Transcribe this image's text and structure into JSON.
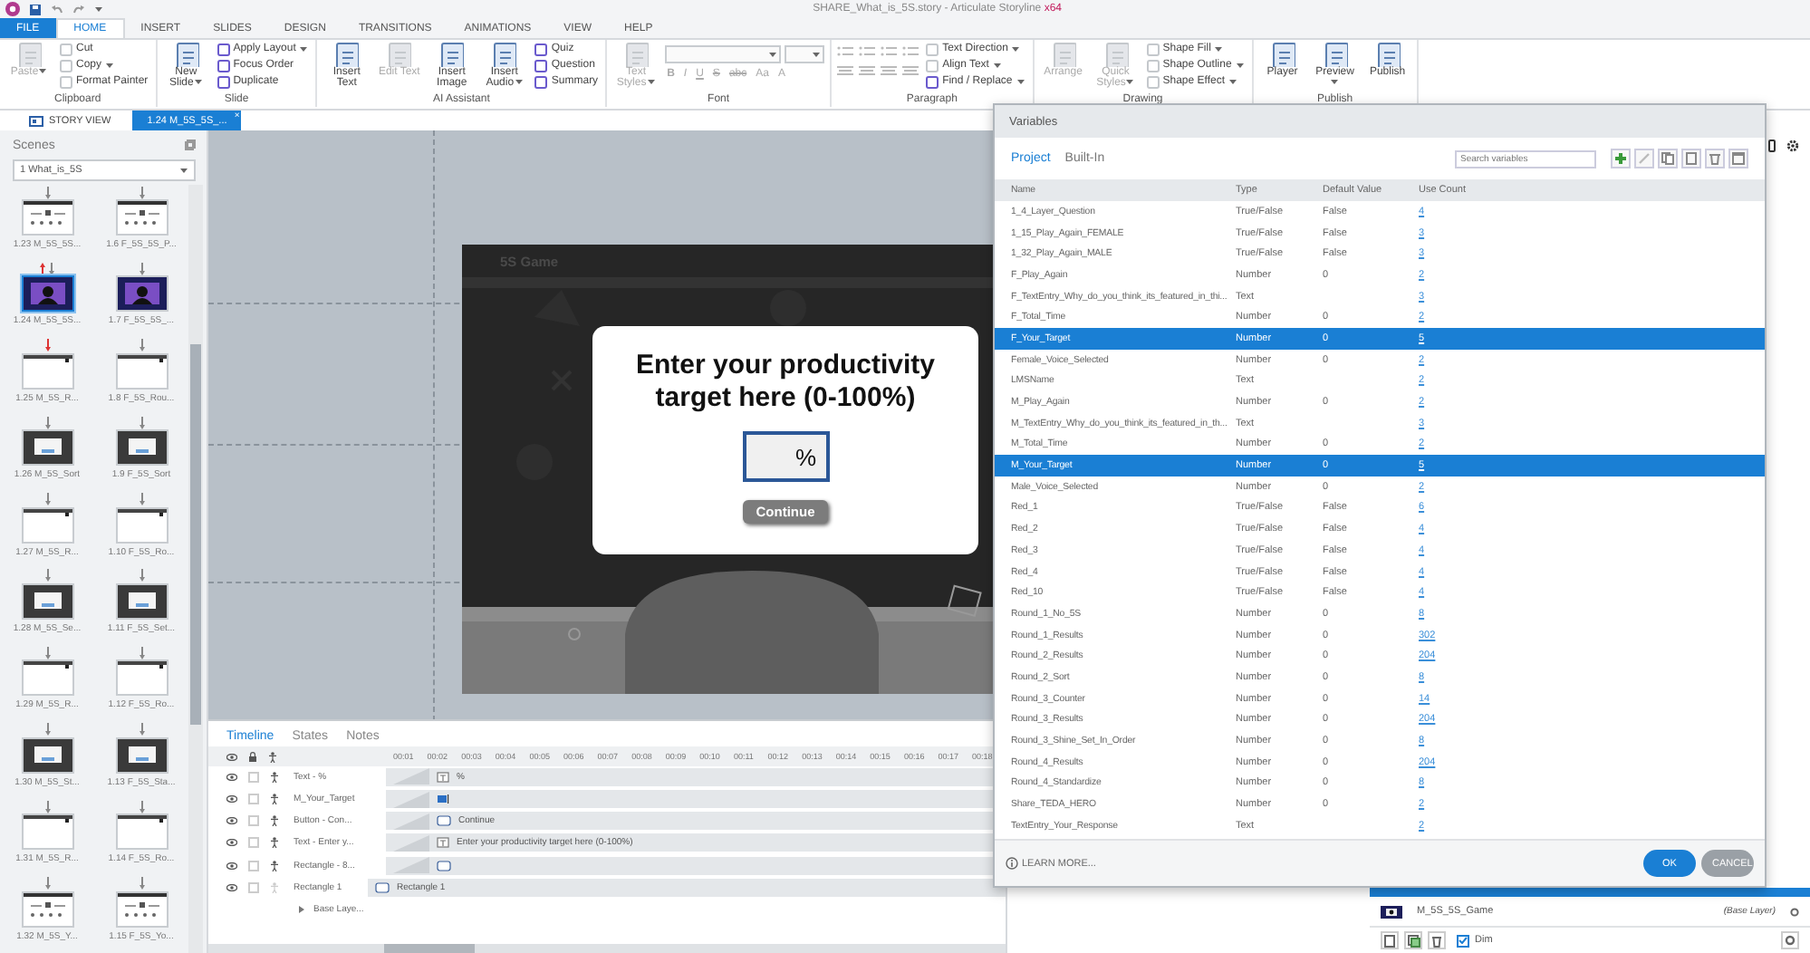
{
  "window": {
    "title": "SHARE_What_is_5S.story - Articulate Storyline",
    "title_suffix": "x64"
  },
  "ribbon_tabs": [
    {
      "label": "FILE",
      "kind": "file",
      "selected": false
    },
    {
      "label": "HOME",
      "kind": "tab",
      "selected": true
    },
    {
      "label": "INSERT",
      "kind": "tab",
      "selected": false
    },
    {
      "label": "SLIDES",
      "kind": "tab",
      "selected": false
    },
    {
      "label": "DESIGN",
      "kind": "tab",
      "selected": false
    },
    {
      "label": "TRANSITIONS",
      "kind": "tab",
      "selected": false
    },
    {
      "label": "ANIMATIONS",
      "kind": "tab",
      "selected": false
    },
    {
      "label": "VIEW",
      "kind": "tab",
      "selected": false
    },
    {
      "label": "HELP",
      "kind": "tab",
      "selected": false
    }
  ],
  "ribbon_groups": [
    {
      "name": "Clipboard",
      "items": [
        {
          "kind": "large",
          "label": "Paste",
          "disabled": true,
          "dropdown": true
        },
        {
          "kind": "stack",
          "buttons": [
            {
              "label": "Cut",
              "disabled": true,
              "dropdown": false
            },
            {
              "label": "Copy",
              "disabled": true,
              "dropdown": true
            },
            {
              "label": "Format Painter",
              "disabled": true,
              "dropdown": false
            }
          ]
        }
      ]
    },
    {
      "name": "Slide",
      "items": [
        {
          "kind": "large",
          "label": "New Slide",
          "disabled": false,
          "dropdown": true
        },
        {
          "kind": "stack",
          "buttons": [
            {
              "label": "Apply Layout",
              "disabled": false,
              "dropdown": true
            },
            {
              "label": "Focus Order",
              "disabled": false,
              "dropdown": false
            },
            {
              "label": "Duplicate",
              "disabled": false,
              "dropdown": false
            }
          ]
        }
      ]
    },
    {
      "name": "AI Assistant",
      "items": [
        {
          "kind": "large",
          "label": "Insert Text",
          "disabled": false,
          "dropdown": false
        },
        {
          "kind": "large",
          "label": "Edit Text",
          "disabled": true,
          "dropdown": false
        },
        {
          "kind": "large",
          "label": "Insert Image",
          "disabled": false,
          "dropdown": false
        },
        {
          "kind": "large",
          "label": "Insert Audio",
          "disabled": false,
          "dropdown": true
        },
        {
          "kind": "stack",
          "buttons": [
            {
              "label": "Quiz",
              "disabled": false,
              "dropdown": false
            },
            {
              "label": "Question",
              "disabled": false,
              "dropdown": false
            },
            {
              "label": "Summary",
              "disabled": false,
              "dropdown": false
            }
          ]
        }
      ]
    },
    {
      "name": "Font",
      "items": [
        {
          "kind": "large",
          "label": "Text Styles",
          "disabled": true,
          "dropdown": true
        },
        {
          "kind": "font",
          "buttons": [
            {
              "label": "B"
            },
            {
              "label": "I"
            },
            {
              "label": "U"
            },
            {
              "label": "S"
            },
            {
              "label": "abc"
            },
            {
              "label": "Aa"
            },
            {
              "label": "A"
            }
          ]
        }
      ]
    },
    {
      "name": "Paragraph",
      "items": [
        {
          "kind": "paragraph"
        },
        {
          "kind": "stack",
          "buttons": [
            {
              "label": "Text Direction",
              "disabled": true,
              "dropdown": true
            },
            {
              "label": "Align Text",
              "disabled": true,
              "dropdown": true
            },
            {
              "label": "Find / Replace",
              "disabled": false,
              "dropdown": true
            }
          ]
        }
      ]
    },
    {
      "name": "Drawing",
      "items": [
        {
          "kind": "large",
          "label": "Arrange",
          "disabled": true,
          "dropdown": false
        },
        {
          "kind": "large",
          "label": "Quick Styles",
          "disabled": true,
          "dropdown": true
        },
        {
          "kind": "stack",
          "buttons": [
            {
              "label": "Shape Fill",
              "disabled": true,
              "dropdown": true
            },
            {
              "label": "Shape Outline",
              "disabled": true,
              "dropdown": true
            },
            {
              "label": "Shape Effect",
              "disabled": true,
              "dropdown": true
            }
          ]
        }
      ]
    },
    {
      "name": "Publish",
      "items": [
        {
          "kind": "large",
          "label": "Player",
          "disabled": false,
          "dropdown": false
        },
        {
          "kind": "large",
          "label": "Preview",
          "disabled": false,
          "dropdown": true
        },
        {
          "kind": "large",
          "label": "Publish",
          "disabled": false,
          "dropdown": false
        }
      ]
    }
  ],
  "doc_tabs": [
    {
      "label": "STORY VIEW",
      "kind": "story",
      "selected": false
    },
    {
      "label": "1.24 M_5S_5S_...",
      "kind": "slide",
      "selected": true,
      "close": "×"
    }
  ],
  "scenes": {
    "title": "Scenes",
    "scene": "1 What_is_5S",
    "slides": [
      {
        "label": "1.23 M_5S_5S...",
        "kind": "calendar",
        "selected": false
      },
      {
        "label": "1.6 F_5S_5S_P...",
        "kind": "calendar",
        "selected": false
      },
      {
        "label": "1.24 M_5S_5S...",
        "kind": "purple",
        "selected": true
      },
      {
        "label": "1.7 F_5S_5S_...",
        "kind": "purple",
        "selected": false
      },
      {
        "label": "1.25 M_5S_R...",
        "kind": "white",
        "selected": false
      },
      {
        "label": "1.8 F_5S_Rou...",
        "kind": "white",
        "selected": false
      },
      {
        "label": "1.26 M_5S_Sort",
        "kind": "dark",
        "selected": false
      },
      {
        "label": "1.9 F_5S_Sort",
        "kind": "dark",
        "selected": false
      },
      {
        "label": "1.27 M_5S_R...",
        "kind": "white",
        "selected": false
      },
      {
        "label": "1.10 F_5S_Ro...",
        "kind": "white",
        "selected": false
      },
      {
        "label": "1.28 M_5S_Se...",
        "kind": "dark",
        "selected": false
      },
      {
        "label": "1.11 F_5S_Set...",
        "kind": "dark",
        "selected": false
      },
      {
        "label": "1.29 M_5S_R...",
        "kind": "white",
        "selected": false
      },
      {
        "label": "1.12 F_5S_Ro...",
        "kind": "white",
        "selected": false
      },
      {
        "label": "1.30 M_5S_St...",
        "kind": "dark",
        "selected": false
      },
      {
        "label": "1.13 F_5S_Sta...",
        "kind": "dark",
        "selected": false
      },
      {
        "label": "1.31 M_5S_R...",
        "kind": "white",
        "selected": false
      },
      {
        "label": "1.14 F_5S_Ro...",
        "kind": "white",
        "selected": false
      },
      {
        "label": "1.32 M_5S_Y...",
        "kind": "calendar",
        "selected": false
      },
      {
        "label": "1.15 F_5S_Yo...",
        "kind": "calendar",
        "selected": false
      }
    ]
  },
  "stage": {
    "slide_title": "5S Game",
    "prompt": "Enter your productivity target here (0-100%)",
    "input_value": "%",
    "button": "Continue"
  },
  "timeline": {
    "tabs": [
      {
        "label": "Timeline",
        "selected": true
      },
      {
        "label": "States",
        "selected": false
      },
      {
        "label": "Notes",
        "selected": false
      }
    ],
    "ticks": [
      "00:01",
      "00:02",
      "00:03",
      "00:04",
      "00:05",
      "00:06",
      "00:07",
      "00:08",
      "00:09",
      "00:10",
      "00:11",
      "00:12",
      "00:13",
      "00:14",
      "00:15",
      "00:16",
      "00:17",
      "00:18"
    ],
    "layers": [
      {
        "name": "Text - %",
        "bar_label": "%",
        "kind": "text",
        "locked": false,
        "locked_icon": true
      },
      {
        "name": "M_Your_Target",
        "kind": "entry",
        "locked": false,
        "locked_icon": true
      },
      {
        "name": "Button - Con...",
        "bar_label": "Continue",
        "kind": "shape",
        "locked": false,
        "locked_icon": true
      },
      {
        "name": "Text - Enter y...",
        "bar_label": "Enter your productivity target here (0-100%)",
        "kind": "text",
        "locked": false,
        "locked_icon": true
      },
      {
        "name": "Rectangle - 8...",
        "kind": "shape",
        "locked": false,
        "locked_icon": true
      },
      {
        "name": "Rectangle 1",
        "bar_label": "Rectangle 1",
        "kind": "base",
        "locked": false,
        "locked_icon": false
      }
    ],
    "base_layer": "Base Laye..."
  },
  "variables": {
    "title": "Variables",
    "tabs": [
      {
        "label": "Project",
        "selected": true
      },
      {
        "label": "Built-In",
        "selected": false
      }
    ],
    "search_placeholder": "Search variables",
    "columns": [
      "Name",
      "Type",
      "Default Value",
      "Use Count"
    ],
    "rows": [
      {
        "name": "1_4_Layer_Question",
        "type": "True/False",
        "default": "False",
        "count": "4",
        "selected": false
      },
      {
        "name": "1_15_Play_Again_FEMALE",
        "type": "True/False",
        "default": "False",
        "count": "3",
        "selected": false
      },
      {
        "name": "1_32_Play_Again_MALE",
        "type": "True/False",
        "default": "False",
        "count": "3",
        "selected": false
      },
      {
        "name": "F_Play_Again",
        "type": "Number",
        "default": "0",
        "count": "2",
        "selected": false
      },
      {
        "name": "F_TextEntry_Why_do_you_think_its_featured_in_thi...",
        "type": "Text",
        "default": "",
        "count": "3",
        "selected": false
      },
      {
        "name": "F_Total_Time",
        "type": "Number",
        "default": "0",
        "count": "2",
        "selected": false
      },
      {
        "name": "F_Your_Target",
        "type": "Number",
        "default": "0",
        "count": "5",
        "selected": true
      },
      {
        "name": "Female_Voice_Selected",
        "type": "Number",
        "default": "0",
        "count": "2",
        "selected": false
      },
      {
        "name": "LMSName",
        "type": "Text",
        "default": "",
        "count": "2",
        "selected": false
      },
      {
        "name": "M_Play_Again",
        "type": "Number",
        "default": "0",
        "count": "2",
        "selected": false
      },
      {
        "name": "M_TextEntry_Why_do_you_think_its_featured_in_th...",
        "type": "Text",
        "default": "",
        "count": "3",
        "selected": false
      },
      {
        "name": "M_Total_Time",
        "type": "Number",
        "default": "0",
        "count": "2",
        "selected": false
      },
      {
        "name": "M_Your_Target",
        "type": "Number",
        "default": "0",
        "count": "5",
        "selected": true
      },
      {
        "name": "Male_Voice_Selected",
        "type": "Number",
        "default": "0",
        "count": "2",
        "selected": false
      },
      {
        "name": "Red_1",
        "type": "True/False",
        "default": "False",
        "count": "6",
        "selected": false
      },
      {
        "name": "Red_2",
        "type": "True/False",
        "default": "False",
        "count": "4",
        "selected": false
      },
      {
        "name": "Red_3",
        "type": "True/False",
        "default": "False",
        "count": "4",
        "selected": false
      },
      {
        "name": "Red_4",
        "type": "True/False",
        "default": "False",
        "count": "4",
        "selected": false
      },
      {
        "name": "Red_10",
        "type": "True/False",
        "default": "False",
        "count": "4",
        "selected": false
      },
      {
        "name": "Round_1_No_5S",
        "type": "Number",
        "default": "0",
        "count": "8",
        "selected": false
      },
      {
        "name": "Round_1_Results",
        "type": "Number",
        "default": "0",
        "count": "302",
        "selected": false
      },
      {
        "name": "Round_2_Results",
        "type": "Number",
        "default": "0",
        "count": "204",
        "selected": false
      },
      {
        "name": "Round_2_Sort",
        "type": "Number",
        "default": "0",
        "count": "8",
        "selected": false
      },
      {
        "name": "Round_3_Counter",
        "type": "Number",
        "default": "0",
        "count": "14",
        "selected": false
      },
      {
        "name": "Round_3_Results",
        "type": "Number",
        "default": "0",
        "count": "204",
        "selected": false
      },
      {
        "name": "Round_3_Shine_Set_In_Order",
        "type": "Number",
        "default": "0",
        "count": "8",
        "selected": false
      },
      {
        "name": "Round_4_Results",
        "type": "Number",
        "default": "0",
        "count": "204",
        "selected": false
      },
      {
        "name": "Round_4_Standardize",
        "type": "Number",
        "default": "0",
        "count": "8",
        "selected": false
      },
      {
        "name": "Share_TEDA_HERO",
        "type": "Number",
        "default": "0",
        "count": "2",
        "selected": false
      },
      {
        "name": "TextEntry_Your_Response",
        "type": "Text",
        "default": "",
        "count": "2",
        "selected": false
      }
    ],
    "learn_more": "LEARN MORE...",
    "ok": "OK",
    "cancel": "CANCEL"
  },
  "right_panel": {
    "layer": {
      "name": "M_5S_5S_Game",
      "note": "(Base Layer)"
    },
    "dim": {
      "label": "Dim",
      "checked": true
    }
  }
}
